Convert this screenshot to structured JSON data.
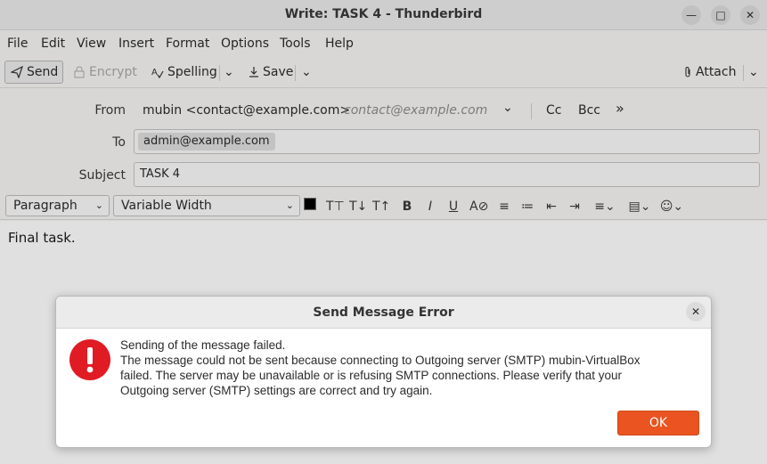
{
  "window": {
    "title": "Write: TASK 4 - Thunderbird"
  },
  "menubar": {
    "items": [
      "File",
      "Edit",
      "View",
      "Insert",
      "Format",
      "Options",
      "Tools",
      "Help"
    ]
  },
  "toolbar": {
    "send_label": "Send",
    "encrypt_label": "Encrypt",
    "spelling_label": "Spelling",
    "save_label": "Save",
    "attach_label": "Attach"
  },
  "header": {
    "from_label": "From",
    "from_identity": "mubin <contact@example.com>",
    "from_address_hint": "contact@example.com",
    "cc_label": "Cc",
    "bcc_label": "Bcc",
    "to_label": "To",
    "to_recipient": "admin@example.com",
    "subject_label": "Subject",
    "subject_value": "TASK 4"
  },
  "formatbar": {
    "paragraph_format": "Paragraph",
    "font_family": "Variable Width"
  },
  "compose": {
    "body_text": "Final task."
  },
  "dialog": {
    "title": "Send Message Error",
    "message_lines": [
      "Sending of the message failed.",
      "The message could not be sent because connecting to Outgoing server (SMTP) mubin-VirtualBox",
      "failed. The server may be unavailable or is refusing SMTP connections. Please verify that your",
      "Outgoing server (SMTP) settings are correct and try again."
    ],
    "ok_label": "OK"
  },
  "colors": {
    "accent": "#e95420",
    "error": "#e01b24"
  }
}
